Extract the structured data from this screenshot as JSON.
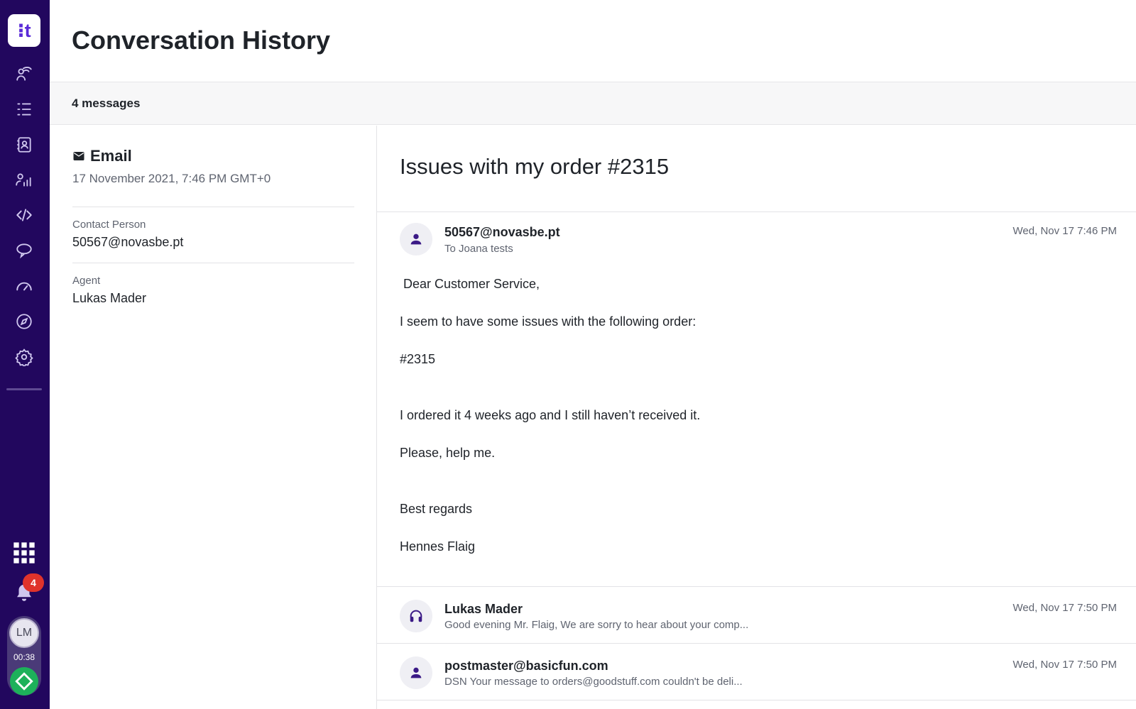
{
  "sidebar": {
    "logo_text": "⁝t",
    "nav_items": [
      "routing-icon",
      "tasks-list-icon",
      "contacts-icon",
      "analytics-icon",
      "code-icon",
      "chat-icon",
      "dashboard-gauge-icon",
      "compass-icon",
      "settings-gear-icon"
    ],
    "notifications_count": "4",
    "user_initials": "LM",
    "session_timer": "00:38",
    "accent_color": "#22075e",
    "status_color": "#1db15a"
  },
  "header": {
    "title": "Conversation History"
  },
  "subbar": {
    "message_count": "4 messages"
  },
  "details": {
    "channel": "Email",
    "date": "17 November 2021, 7:46 PM GMT+0",
    "contact_label": "Contact Person",
    "contact_value": "50567@novasbe.pt",
    "agent_label": "Agent",
    "agent_value": "Lukas Mader"
  },
  "conversation": {
    "subject": "Issues with my order #2315",
    "messages": [
      {
        "sender": "50567@novasbe.pt",
        "recipient_line": "To Joana tests",
        "time": "Wed, Nov 17 7:46 PM",
        "avatar_icon": "person-icon",
        "body": [
          " Dear Customer Service,",
          "I seem to have some issues with the following order:",
          "#2315",
          "I ordered it 4 weeks ago and I still haven’t received it.",
          "Please, help me.",
          "Best regards",
          "Hennes Flaig"
        ]
      },
      {
        "sender": "Lukas Mader",
        "preview": "Good evening Mr. Flaig, We are sorry to hear about your comp...",
        "time": "Wed, Nov 17 7:50 PM",
        "avatar_icon": "headset-icon"
      },
      {
        "sender": "postmaster@basicfun.com",
        "preview": "DSN Your message to orders@goodstuff.com couldn't be deli...",
        "time": "Wed, Nov 17 7:50 PM",
        "avatar_icon": "person-icon"
      }
    ]
  }
}
